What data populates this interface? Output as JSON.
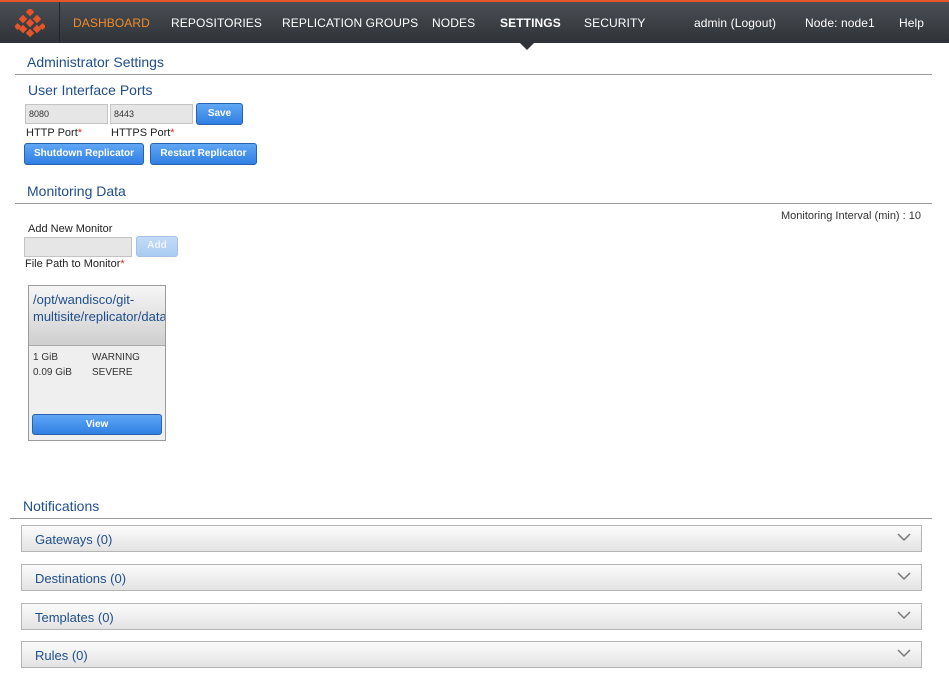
{
  "nav": {
    "items": [
      "DASHBOARD",
      "REPOSITORIES",
      "REPLICATION GROUPS",
      "NODES",
      "SETTINGS",
      "SECURITY"
    ],
    "user": "admin (Logout)",
    "node": "Node: node1",
    "help": "Help",
    "colors": {
      "active": "#f28c28",
      "accent_bar": "#e8542a"
    }
  },
  "admin": {
    "title": "Administrator Settings",
    "ports": {
      "title": "User Interface Ports",
      "http_value": "8080",
      "https_value": "8443",
      "http_label": "HTTP Port",
      "https_label": "HTTPS Port",
      "required_mark": "*",
      "save_label": "Save",
      "shutdown_label": "Shutdown Replicator",
      "restart_label": "Restart Replicator"
    }
  },
  "monitoring": {
    "title": "Monitoring Data",
    "interval": "Monitoring Interval (min) : 10",
    "add_title": "Add New Monitor",
    "path_value": "",
    "add_label": "Add",
    "path_label": "File Path to Monitor",
    "card": {
      "path": "/opt/wandisco/git-multisite/replicator/databa...",
      "thresholds": [
        {
          "size": "1 GiB",
          "level": "WARNING"
        },
        {
          "size": "0.09 GiB",
          "level": "SEVERE"
        }
      ],
      "view_label": "View"
    }
  },
  "notifications": {
    "title": "Notifications",
    "panels": [
      "Gateways (0)",
      "Destinations (0)",
      "Templates (0)",
      "Rules (0)"
    ]
  }
}
